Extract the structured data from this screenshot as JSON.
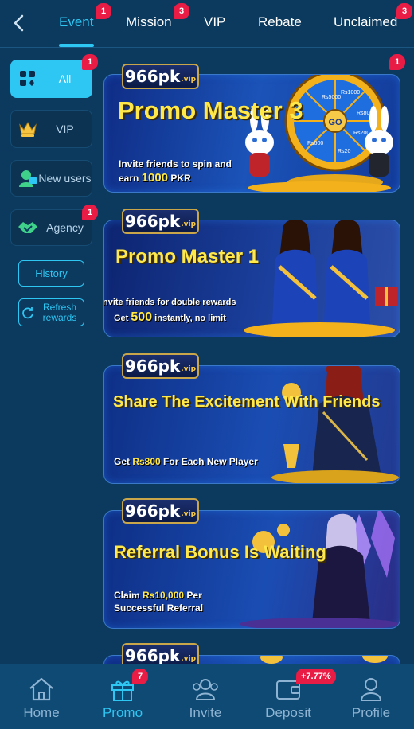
{
  "tabs": [
    {
      "label": "Event",
      "badge": "1",
      "active": true
    },
    {
      "label": "Mission",
      "badge": "3"
    },
    {
      "label": "VIP"
    },
    {
      "label": "Rebate"
    },
    {
      "label": "Unclaimed",
      "badge": "3"
    }
  ],
  "sidebar": {
    "items": [
      {
        "label": "All",
        "badge": "1",
        "icon": "grid-icon",
        "active": true
      },
      {
        "label": "VIP",
        "icon": "crown-icon"
      },
      {
        "label": "New users",
        "icon": "user-chat-icon"
      },
      {
        "label": "Agency",
        "badge": "1",
        "icon": "handshake-icon"
      }
    ],
    "history_label": "History",
    "refresh_label": "Refresh rewards"
  },
  "banners": [
    {
      "logo": "966pk",
      "logo_suffix": ".vip",
      "title": "Promo Master 3",
      "sub_line1": "Invite friends to spin and",
      "sub_line2_pre": "earn ",
      "sub_line2_hl": "1000",
      "sub_line2_post": " PKR",
      "badge": "1"
    },
    {
      "logo": "966pk",
      "logo_suffix": ".vip",
      "title": "Promo Master 1",
      "sub_line1": "nvite friends for double rewards",
      "sub_line2_pre": "Get ",
      "sub_line2_hl": "500",
      "sub_line2_post": " instantly, no limit"
    },
    {
      "logo": "966pk",
      "logo_suffix": ".vip",
      "title": "Share The Excitement With Friends",
      "sub_line1_pre": "Get ",
      "sub_line1_hl": "Rs800",
      "sub_line1_post": " For Each New Player"
    },
    {
      "logo": "966pk",
      "logo_suffix": ".vip",
      "title": "Referral Bonus Is Waiting",
      "sub_line1_pre": "Claim ",
      "sub_line1_hl": "Rs10,000",
      "sub_line1_post": " Per",
      "sub_line2": "Successful Referral"
    },
    {
      "logo": "966pk",
      "logo_suffix": ".vip"
    }
  ],
  "wheel_labels": [
    "Rs5000",
    "Rs1000",
    "Rs800",
    "Rs200",
    "Rs20",
    "Rs600",
    "GO"
  ],
  "bottom_nav": [
    {
      "label": "Home",
      "icon": "home-icon"
    },
    {
      "label": "Promo",
      "icon": "gift-icon",
      "badge": "7",
      "active": true
    },
    {
      "label": "Invite",
      "icon": "invite-icon"
    },
    {
      "label": "Deposit",
      "icon": "wallet-icon",
      "badge": "+7.77%"
    },
    {
      "label": "Profile",
      "icon": "profile-icon"
    }
  ],
  "colors": {
    "accent": "#2ec6f3",
    "background": "#0b3a5e",
    "badge": "#e81c44",
    "title_yellow": "#ffe84a"
  }
}
